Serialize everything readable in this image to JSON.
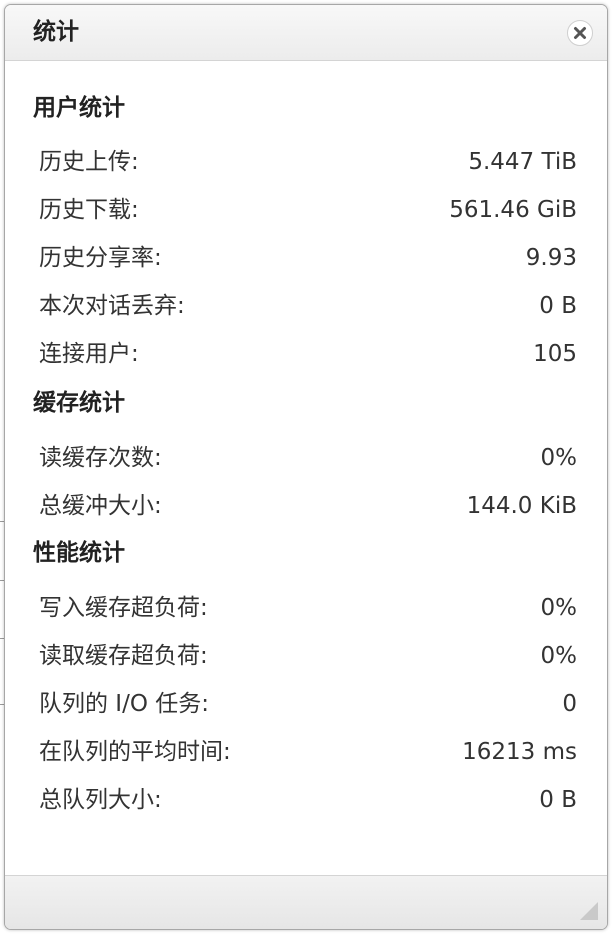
{
  "dialog": {
    "title": "统计"
  },
  "sections": [
    {
      "title": "用户统计",
      "rows": [
        {
          "label": "历史上传:",
          "value": "5.447 TiB"
        },
        {
          "label": "历史下载:",
          "value": "561.46 GiB"
        },
        {
          "label": "历史分享率:",
          "value": "9.93"
        },
        {
          "label": "本次对话丢弃:",
          "value": "0 B"
        },
        {
          "label": "连接用户:",
          "value": "105"
        }
      ]
    },
    {
      "title": "缓存统计",
      "rows": [
        {
          "label": "读缓存次数:",
          "value": "0%"
        },
        {
          "label": "总缓冲大小:",
          "value": "144.0 KiB"
        }
      ]
    },
    {
      "title": "性能统计",
      "rows": [
        {
          "label": "写入缓存超负荷:",
          "value": "0%"
        },
        {
          "label": "读取缓存超负荷:",
          "value": "0%"
        },
        {
          "label": "队列的 I/O 任务:",
          "value": "0"
        },
        {
          "label": "在队列的平均时间:",
          "value": "16213 ms"
        },
        {
          "label": "总队列大小:",
          "value": "0 B"
        }
      ]
    }
  ],
  "icons": {
    "close": "close-icon",
    "resize": "resize-grip-icon"
  },
  "colors": {
    "text": "#333333",
    "title": "#222222",
    "border": "#a7a7a7",
    "footer": "#e6e6e6"
  }
}
